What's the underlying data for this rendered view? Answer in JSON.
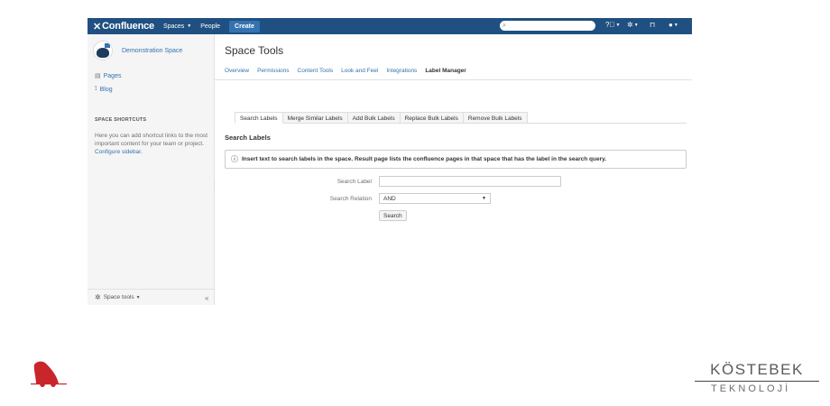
{
  "topbar": {
    "logo": "Confluence",
    "nav": [
      {
        "label": "Spaces"
      },
      {
        "label": "People"
      }
    ],
    "create_label": "Create",
    "search_placeholder": ""
  },
  "sidebar": {
    "space_name": "Demonstration Space",
    "links": [
      {
        "label": "Pages"
      },
      {
        "label": "Blog"
      }
    ],
    "shortcuts_title": "SPACE SHORTCUTS",
    "shortcuts_text": "Here you can add shortcut links to the most important content for your team or project.",
    "shortcuts_link": "Configure sidebar.",
    "footer_label": "Space tools",
    "collapse_label": "«"
  },
  "main": {
    "title": "Space Tools",
    "subnav": [
      {
        "label": "Overview"
      },
      {
        "label": "Permissions"
      },
      {
        "label": "Content Tools"
      },
      {
        "label": "Look and Feel"
      },
      {
        "label": "Integrations"
      },
      {
        "label": "Label Manager"
      }
    ],
    "tabs": [
      {
        "label": "Search Labels"
      },
      {
        "label": "Merge Similar Labels"
      },
      {
        "label": "Add Bulk Labels"
      },
      {
        "label": "Replace Bulk Labels"
      },
      {
        "label": "Remove Bulk Labels"
      }
    ],
    "section_title": "Search Labels",
    "info_text": "Insert text to search labels in the space. Result page lists the confluence pages in that space that has the label in the search query.",
    "form": {
      "search_label": "Search Label",
      "search_value": "",
      "relation_label": "Search Relation",
      "relation_value": "AND",
      "search_button": "Search"
    }
  },
  "branding": {
    "name": "KÖSTEBEK",
    "sub": "TEKNOLOJİ"
  },
  "colors": {
    "topbar": "#205081",
    "link": "#3572b0",
    "mascot": "#c8262b"
  }
}
